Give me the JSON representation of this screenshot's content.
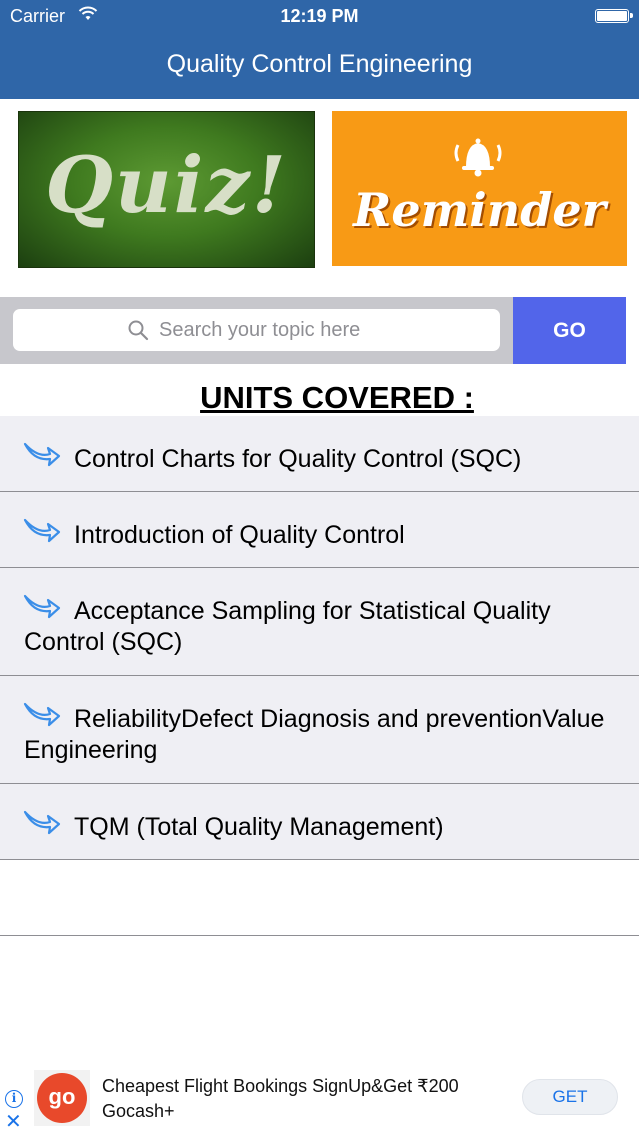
{
  "status_bar": {
    "carrier": "Carrier",
    "time": "12:19 PM"
  },
  "header": {
    "title": "Quality Control Engineering"
  },
  "banners": {
    "quiz_label": "Quiz!",
    "reminder_label": "Reminder"
  },
  "search": {
    "placeholder": "Search your topic here",
    "value": "",
    "go_label": "GO"
  },
  "units": {
    "title": "UNITS COVERED :",
    "items": [
      {
        "label": "Control Charts for Quality Control (SQC)"
      },
      {
        "label": "Introduction of Quality Control"
      },
      {
        "label": "Acceptance Sampling for Statistical Quality Control (SQC)"
      },
      {
        "label": "ReliabilityDefect Diagnosis and preventionValue Engineering"
      },
      {
        "label": "TQM (Total Quality Management)"
      }
    ]
  },
  "ad": {
    "logo_text": "go",
    "text": "Cheapest Flight Bookings SignUp&Get ₹200 Gocash+",
    "cta_label": "GET"
  },
  "colors": {
    "header": "#2f66a8",
    "go_button": "#5265ea",
    "reminder_banner": "#f89a15",
    "list_row": "#efeff4",
    "arrow": "#3b8ee8"
  },
  "icons": {
    "status": [
      "wifi-icon",
      "battery-icon"
    ],
    "search": "search-icon",
    "list": "arrow-right-icon",
    "reminder": "bell-icon",
    "ad": [
      "info-icon",
      "close-icon"
    ]
  }
}
